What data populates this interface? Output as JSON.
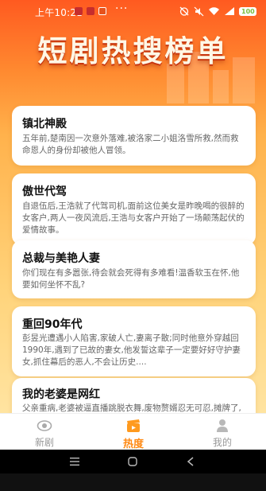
{
  "status_bar": {
    "time": "上午10:21",
    "dots": "···",
    "battery": "100"
  },
  "header": {
    "title": "短剧热搜榜单"
  },
  "dramas": [
    {
      "title": "镇北神殿",
      "desc": "五年前,楚南因一次意外落难,被洛家二小姐洛雪所救,然而救命恩人的身份却被他人冒领。"
    },
    {
      "title": "傲世代驾",
      "desc": "自退伍后,王浩就了代驾司机,面前这位美女是昨晚喝的很醉的女客户,两人一夜风流后,王浩与女客户开始了一场颠荡起伏的爱情故事。"
    },
    {
      "title": "总裁与美艳人妻",
      "desc": "你们现在有多嚣张,待会就会死得有多难看!温香软玉在怀,他要如何坐怀不乱?"
    },
    {
      "title": "重回90年代",
      "desc": "彭昱光遭遇小人陷害,家破人亡,妻离子散;同时他意外穿越回1990年,遇到了已故的妻女,他发誓这辈子一定要好好守护妻女,抓住幕后的恶人,不会让历史...."
    },
    {
      "title": "我的老婆是网红",
      "desc": "父亲重病,老婆被逼直播跳脱衣舞,废物赘婿忍无可忍,摊牌了,我不装了!"
    }
  ],
  "tabs": [
    {
      "label": "新剧",
      "icon": "eye-icon"
    },
    {
      "label": "热度",
      "icon": "clapperboard-icon"
    },
    {
      "label": "我的",
      "icon": "person-icon"
    }
  ],
  "colors": {
    "accent": "#ff8a14",
    "header_top": "#ff5a20",
    "background_bottom": "#fff0c8"
  }
}
